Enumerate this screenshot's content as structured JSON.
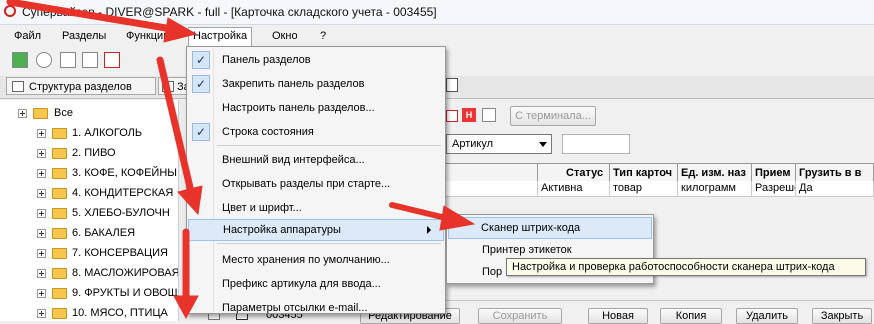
{
  "window": {
    "title": "Супервайзер - DIVER@SPARK - full - [Карточка складского учета - 003455]"
  },
  "menubar": [
    {
      "label": "Файл"
    },
    {
      "label": "Разделы"
    },
    {
      "label": "Функции"
    },
    {
      "label": "Настройка"
    },
    {
      "label": "Окно"
    },
    {
      "label": "?"
    }
  ],
  "tabs": [
    {
      "label": "Структура разделов"
    },
    {
      "label": "За"
    }
  ],
  "tree": {
    "root": "Все",
    "items": [
      "1. АЛКОГОЛЬ",
      "2. ПИВО",
      "3. КОФЕ, КОФЕЙНЫ",
      "4. КОНДИТЕРСКАЯ",
      "5. ХЛЕБО-БУЛОЧН",
      "6. БАКАЛЕЯ",
      "7. КОНСЕРВАЦИЯ",
      "8. МАСЛОЖИРОВАЯ",
      "9. ФРУКТЫ И ОВОЩ",
      "10. МЯСО, ПТИЦА"
    ]
  },
  "right_panel": {
    "terminal_button": "С терминала...",
    "field_select": "Артикул",
    "grid_headers": [
      "Статус",
      "Тип карточ",
      "Ед. изм. наз",
      "Прием",
      "Грузить в в"
    ],
    "grid_row": [
      "Активна",
      "товар",
      "килограмм",
      "Разреше",
      "Да"
    ],
    "record_code": "003455",
    "bottom_buttons": [
      "Редактирование",
      "Сохранить",
      "Новая",
      "Копия",
      "Удалить",
      "Закрыть"
    ]
  },
  "settings_menu": {
    "items": [
      {
        "label": "Панель разделов",
        "checked": true
      },
      {
        "label": "Закрепить панель разделов",
        "checked": true
      },
      {
        "label": "Настроить панель разделов...",
        "checked": false
      },
      {
        "label": "Строка состояния",
        "checked": true
      },
      {
        "label": "Внешний вид интерфейса...",
        "checked": false
      },
      {
        "label": "Открывать разделы при старте...",
        "checked": false
      },
      {
        "label": "Цвет и шрифт...",
        "checked": false
      },
      {
        "label": "Настройка аппаратуры",
        "checked": false
      },
      {
        "label": "Место хранения по умолчанию...",
        "checked": false
      },
      {
        "label": "Префикс артикула для ввода...",
        "checked": false
      },
      {
        "label": "Параметры отсылки e-mail...",
        "checked": false
      }
    ]
  },
  "hardware_submenu": {
    "items": [
      {
        "label": "Сканер штрих-кода"
      },
      {
        "label": "Принтер этикеток"
      },
      {
        "label": "Пор"
      }
    ]
  },
  "tooltip": {
    "text": "Настройка и проверка работоспособности сканера штрих-кода"
  },
  "colors": {
    "highlight": "#dbe9f8",
    "arrow": "#e8332a",
    "folder": "#f6c74c"
  }
}
